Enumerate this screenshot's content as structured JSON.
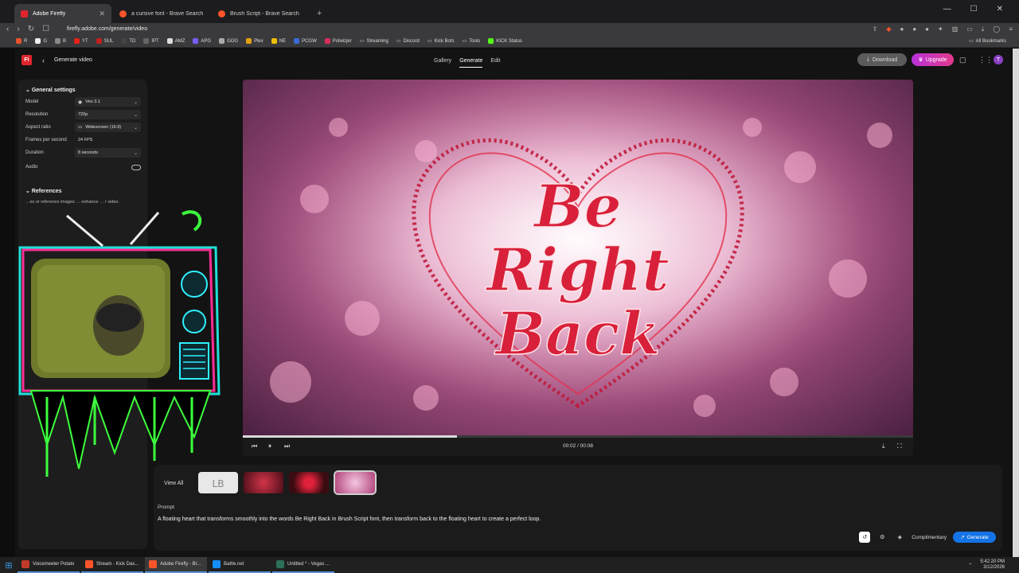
{
  "browser": {
    "tabs": [
      {
        "title": "Adobe Firefly",
        "active": true,
        "color": "#e0242c"
      },
      {
        "title": "a cursive font - Brave Search",
        "active": false,
        "color": "#fb542b"
      },
      {
        "title": "Brush Script - Brave Search",
        "active": false,
        "color": "#fb542b"
      }
    ],
    "url": "firefly.adobe.com/generate/video",
    "bookmarks": [
      "R",
      "G",
      "B",
      "YT",
      "SUL",
      "TD",
      "IPT",
      "AMZ",
      "APG",
      "GOG",
      "Plex",
      "NE",
      "PCGW",
      "Polwizjer",
      "Streaming",
      "Discord",
      "Kick Bots",
      "Tools",
      "KICK Status"
    ],
    "all_bookmarks": "All Bookmarks"
  },
  "app": {
    "logo": "Fi",
    "page_title": "Generate video",
    "nav": [
      "Gallery",
      "Generate",
      "Edit"
    ],
    "nav_active": "Generate",
    "download": "Download",
    "upgrade": "Upgrade",
    "avatar": "T"
  },
  "settings": {
    "section": "General settings",
    "model_label": "Model",
    "model_value": "Veo 3.1",
    "resolution_label": "Resolution",
    "resolution_value": "720p",
    "aspect_label": "Aspect ratio",
    "aspect_value": "Widescreen (16:9)",
    "fps_label": "Frames per second",
    "fps_value": "24 FPS",
    "duration_label": "Duration",
    "duration_value": "8 seconds",
    "audio_label": "Audio",
    "references": "References",
    "references_hint": "…es or reference images … enhance … r video."
  },
  "player": {
    "time": "00:02 / 00:08",
    "progress": 0.32
  },
  "gallery": {
    "view_all": "View All"
  },
  "prompt": {
    "label": "Prompt",
    "text": "A floating heart that transforms smoothly into the words Be Right Back in Brush Script font, then transform back to the floating heart to create a perfect loop.",
    "complimentary": "Complimentary",
    "generate": "Generate"
  },
  "taskbar": {
    "items": [
      {
        "title": "Voicemeeter Potato",
        "color": "#c23b2a"
      },
      {
        "title": "Stream - Kick Das...",
        "color": "#fb542b"
      },
      {
        "title": "Adobe Firefly - Br...",
        "color": "#fb542b"
      },
      {
        "title": "Battle.net",
        "color": "#148eff"
      },
      {
        "title": "Untitled * - Vegas ...",
        "color": "#2c6f5a"
      }
    ],
    "time": "5:42:20 PM",
    "date": "3/12/2026"
  }
}
